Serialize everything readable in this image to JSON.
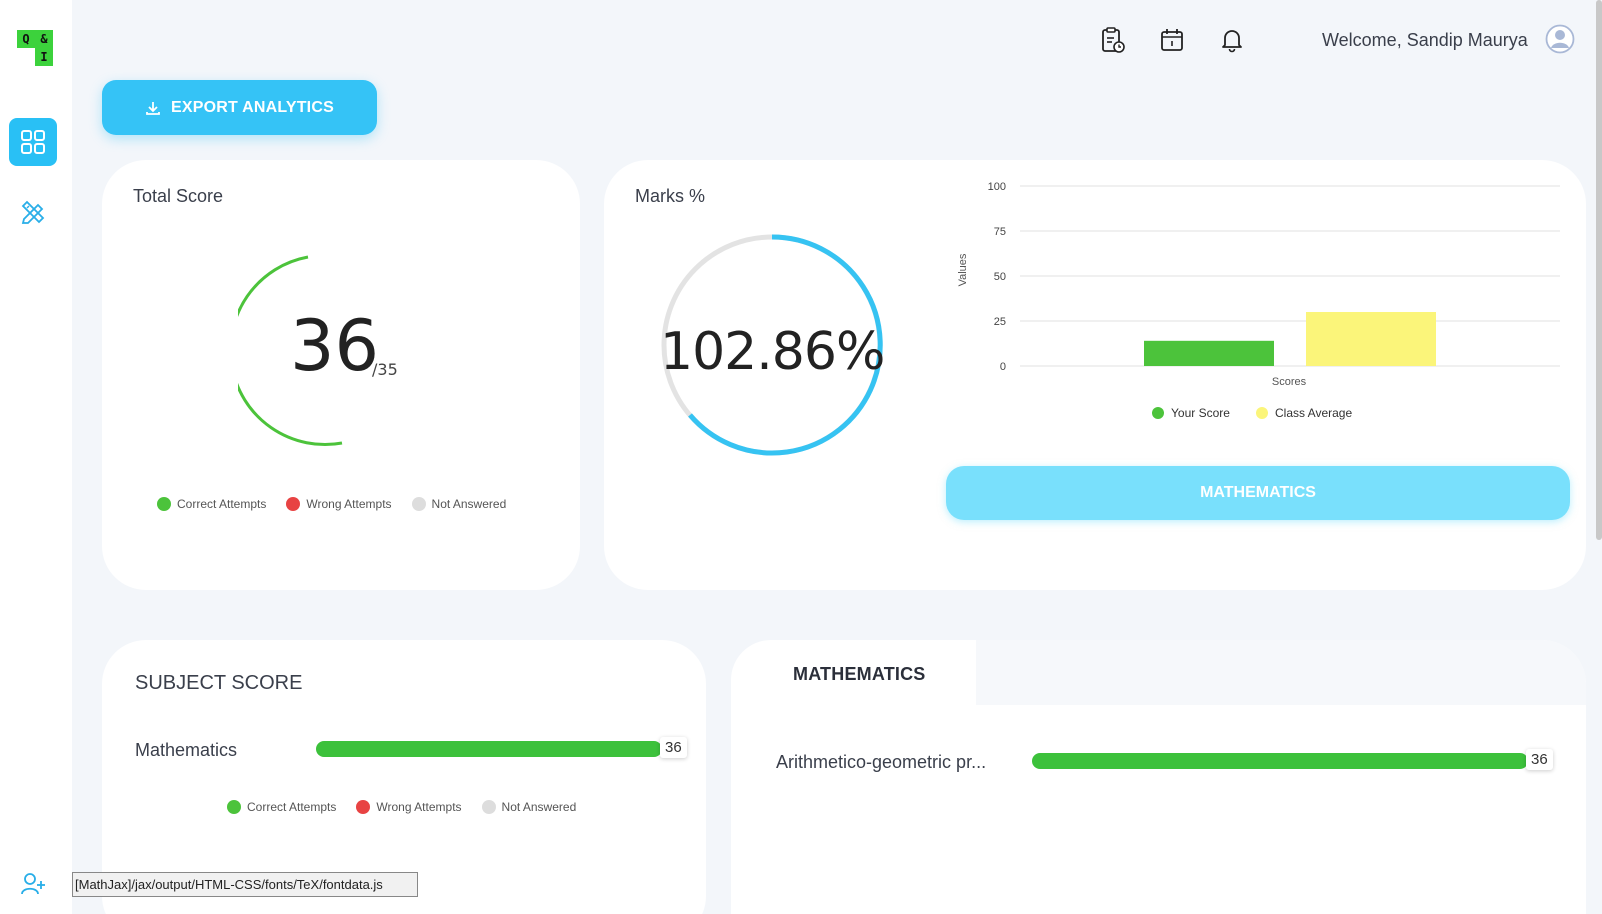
{
  "brand": {
    "logo_letters": [
      "Q",
      "&",
      "",
      "I"
    ]
  },
  "sidebar": {
    "items": [
      {
        "icon": "dashboard-grid-icon",
        "active": true
      },
      {
        "icon": "pencil-ruler-icon",
        "active": false
      },
      {
        "icon": "add-user-icon",
        "active": false
      }
    ]
  },
  "topbar": {
    "icons": [
      "clipboard-clock-icon",
      "calendar-icon",
      "bell-icon"
    ],
    "welcome": "Welcome, Sandip Maurya"
  },
  "export": {
    "label": "EXPORT ANALYTICS"
  },
  "total_score": {
    "title": "Total Score",
    "score": "36",
    "total": "/35",
    "legend": [
      "Correct Attempts",
      "Wrong Attempts",
      "Not Answered"
    ]
  },
  "marks": {
    "title": "Marks %",
    "percent_label": "102.86%",
    "subject_button": "MATHEMATICS"
  },
  "chart_data": {
    "type": "bar",
    "categories": [
      "Scores"
    ],
    "series": [
      {
        "name": "Your Score",
        "values": [
          14
        ],
        "color": "#4cc33b"
      },
      {
        "name": "Class Average",
        "values": [
          30
        ],
        "color": "#fbf57a"
      }
    ],
    "xlabel": "Scores",
    "ylabel": "Values",
    "ylim": [
      0,
      100
    ],
    "yticks": [
      "100",
      "75",
      "50",
      "25",
      "0"
    ],
    "grid": true,
    "legend_position": "bottom"
  },
  "subject_score": {
    "title": "SUBJECT SCORE",
    "rows": [
      {
        "label": "Mathematics",
        "value": "36"
      }
    ],
    "legend": [
      "Correct Attempts",
      "Wrong Attempts",
      "Not Answered"
    ]
  },
  "topic_panel": {
    "tab": "MATHEMATICS",
    "rows": [
      {
        "label": "Arithmetico-geometric pr...",
        "value": "36"
      }
    ]
  },
  "tooltip": "[MathJax]/jax/output/HTML-CSS/fonts/TeX/fontdata.js",
  "colors": {
    "accent": "#35c3f6",
    "correct": "#3cc13b",
    "wrong": "#e84343",
    "unanswered": "#dddddd"
  }
}
